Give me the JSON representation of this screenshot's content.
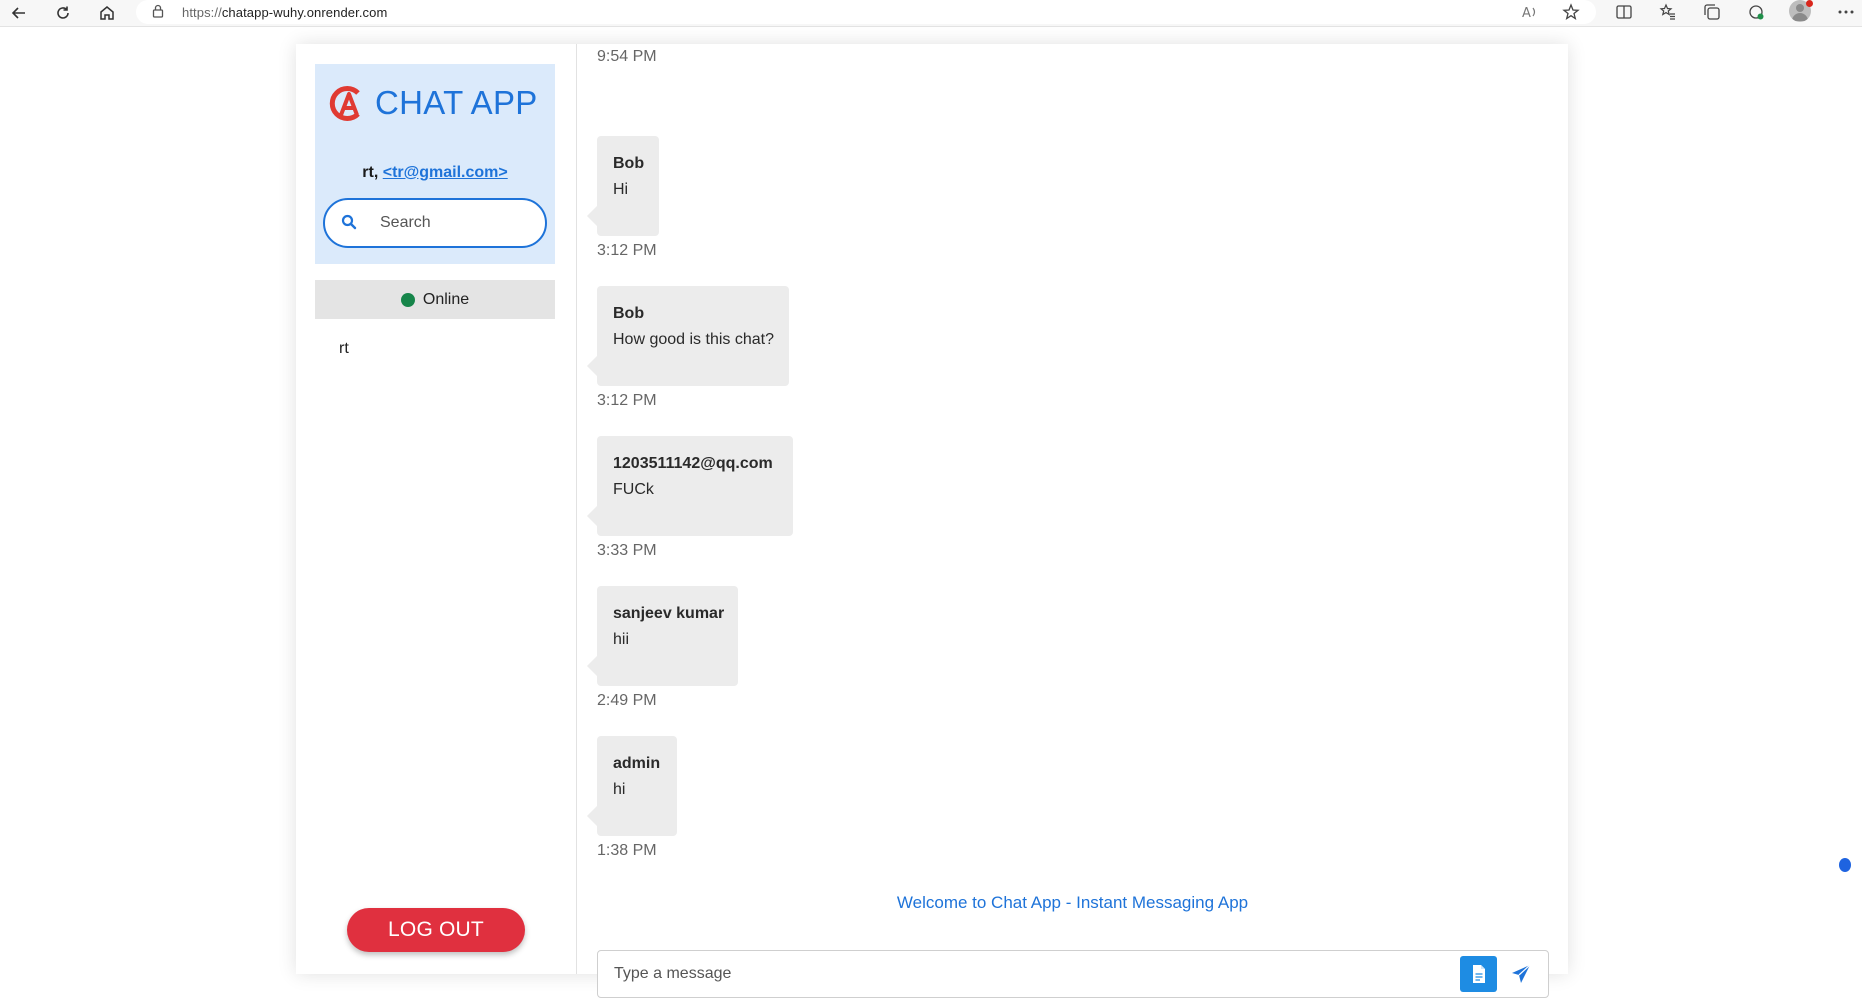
{
  "browser": {
    "url_scheme": "https://",
    "url_host": "chatapp-wuhy.onrender.com",
    "icons": [
      "back-icon",
      "refresh-icon",
      "home-icon",
      "lock-icon",
      "read-aloud-icon",
      "favorite-star-icon",
      "split-screen-icon",
      "favorites-icon",
      "collections-icon",
      "extensions-icon",
      "profile-icon",
      "more-icon"
    ]
  },
  "sidebar": {
    "brand_title": "CHAT APP",
    "user_name": "rt,",
    "user_email": "<tr@gmail.com>",
    "search_placeholder": "Search",
    "online_label": "Online",
    "online_users": [
      "rt"
    ],
    "logout_label": "LOG OUT"
  },
  "chat": {
    "top_time": "9:54 PM",
    "messages": [
      {
        "sender": "Bob",
        "text": "Hi",
        "time": "3:12 PM"
      },
      {
        "sender": "Bob",
        "text": "How good is this chat?",
        "time": "3:12 PM"
      },
      {
        "sender": "1203511142@qq.com",
        "text": "FUCk",
        "time": "3:33 PM"
      },
      {
        "sender": "sanjeev kumar",
        "text": "hii",
        "time": "2:49 PM"
      },
      {
        "sender": "admin",
        "text": "hi",
        "time": "1:38 PM"
      }
    ],
    "welcome": "Welcome to Chat App - Instant Messaging App",
    "message_placeholder": "Type a message"
  },
  "colors": {
    "accent": "#1e73d9",
    "brand_card_bg": "#dbeafb",
    "logout": "#e0303f",
    "online": "#16854a",
    "bubble": "#ececec"
  }
}
